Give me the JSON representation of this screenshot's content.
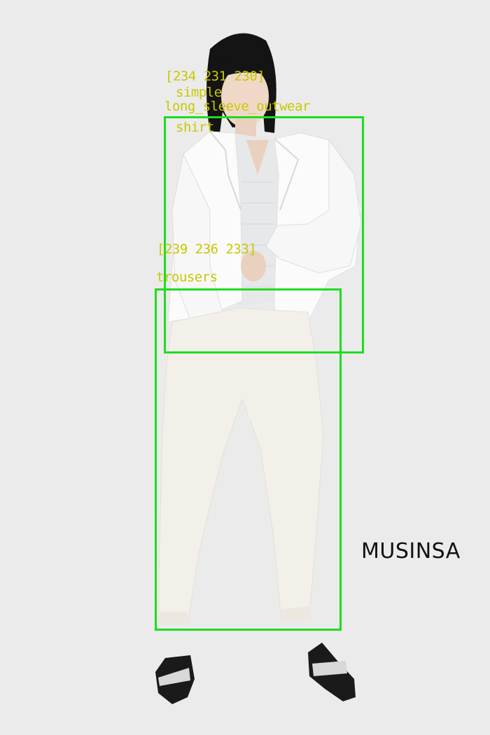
{
  "brand": {
    "text": "MUSINSA"
  },
  "detections": [
    {
      "id": "outerwear",
      "color_label": "[234 231 230]",
      "style_label": "simple",
      "category_label": "long_sleeve_outwear",
      "sub_label": "shirt"
    },
    {
      "id": "trousers",
      "color_label": "[239 236 233]",
      "category_label": "trousers"
    }
  ],
  "colors": {
    "background": "#ebebeb",
    "box": "#1fdc1f",
    "annotation_text": "#c8c800",
    "garment": "#f3f0ea",
    "shirt_stripe": "#e6e8ea"
  }
}
